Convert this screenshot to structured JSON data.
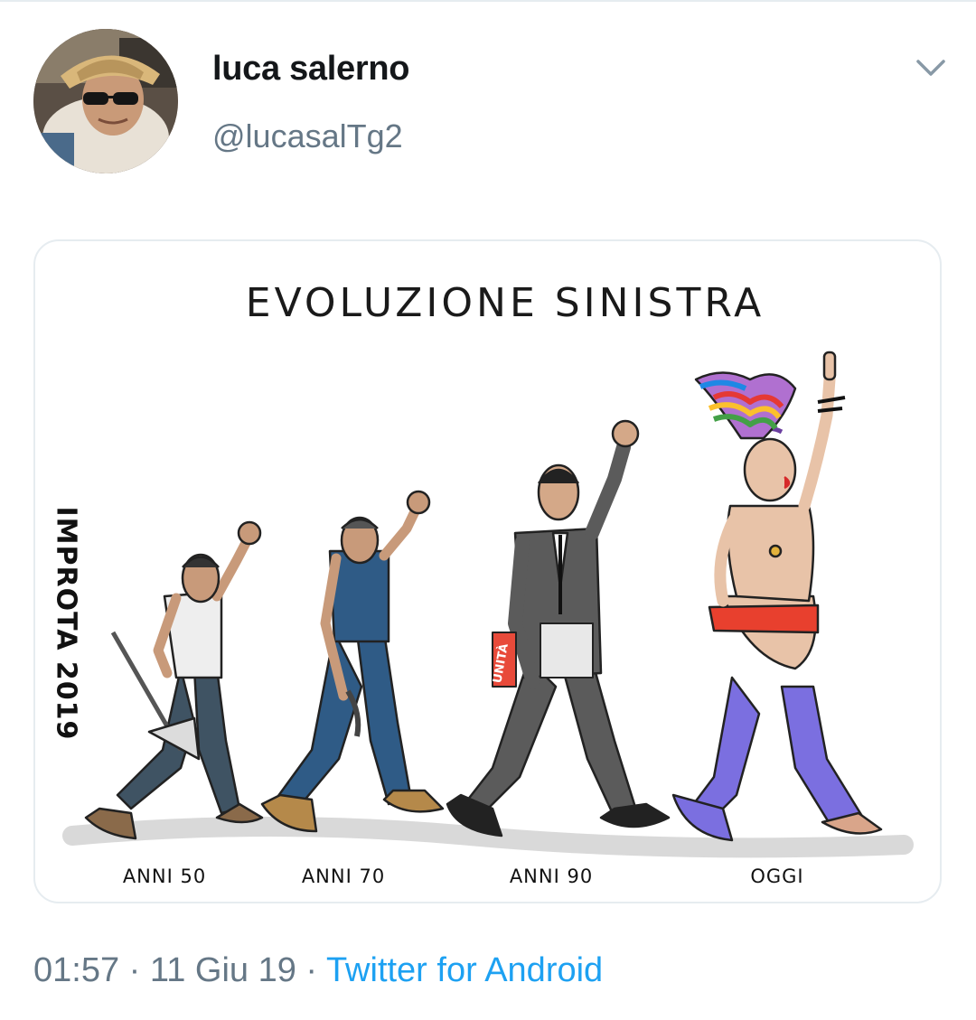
{
  "tweet": {
    "display_name": "luca salerno",
    "handle": "@lucasalTg2",
    "time": "01:57",
    "separator1": " · ",
    "date": "11 Giu 19",
    "separator2": " · ",
    "source": "Twitter for Android"
  },
  "media": {
    "cartoon_title": "EVOLUZIONE SINISTRA",
    "signature": "IMPROTA 2019",
    "newspaper_label": "UNITÀ",
    "eras": [
      "ANNI 50",
      "ANNI 70",
      "ANNI 90",
      "OGGI"
    ]
  },
  "icons": {
    "more": "chevron-down-icon",
    "avatar": "avatar"
  },
  "colors": {
    "name": "#14171a",
    "secondary": "#657786",
    "link": "#1da1f2",
    "border": "#e6ecf0"
  }
}
